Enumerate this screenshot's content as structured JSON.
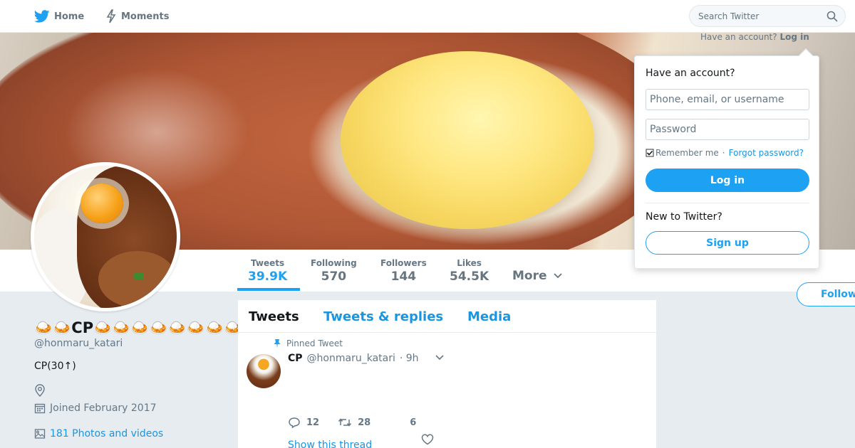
{
  "colors": {
    "accent": "#1da1f2",
    "link": "#1b95e0",
    "text_muted": "#657786",
    "background": "#e6ecf0"
  },
  "nav": {
    "home_label": "Home",
    "home_icon": "twitter-bird-icon",
    "moments_label": "Moments",
    "moments_icon": "lightning-icon",
    "search_placeholder": "Search Twitter",
    "search_icon": "search-icon"
  },
  "account_prompt": {
    "text": "Have an account?",
    "login_label": "Log in"
  },
  "login_dropdown": {
    "title": "Have an account?",
    "username_placeholder": "Phone, email, or username",
    "password_placeholder": "Password",
    "remember_label": "Remember me",
    "separator": "·",
    "forgot_label": "Forgot password?",
    "login_button": "Log in",
    "new_label": "New to Twitter?",
    "signup_button": "Sign up"
  },
  "stats": [
    {
      "label": "Tweets",
      "value": "39.9K",
      "active": true
    },
    {
      "label": "Following",
      "value": "570"
    },
    {
      "label": "Followers",
      "value": "144"
    },
    {
      "label": "Likes",
      "value": "54.5K"
    }
  ],
  "more_label": "More",
  "follow_label": "Follow",
  "profile": {
    "name": "🍛🍛CP🍛🍛🍛🍛🍛🍛🍛🍛🍛🍛",
    "handle": "@honmaru_katari",
    "bio": "CP(30↑)",
    "location_icon": "location-pin-icon",
    "joined": "Joined February 2017",
    "joined_icon": "calendar-icon",
    "photos": "181 Photos and videos",
    "photos_icon": "photo-icon"
  },
  "timeline": {
    "tabs": [
      {
        "label": "Tweets",
        "active": true
      },
      {
        "label": "Tweets & replies"
      },
      {
        "label": "Media"
      }
    ],
    "tweet": {
      "pinned_label": "Pinned Tweet",
      "name": "CP",
      "handle": "@honmaru_katari",
      "time": "· 9h",
      "reply_count": "12",
      "retweet_count": "28",
      "like_count": "6",
      "show_thread": "Show this thread"
    }
  }
}
